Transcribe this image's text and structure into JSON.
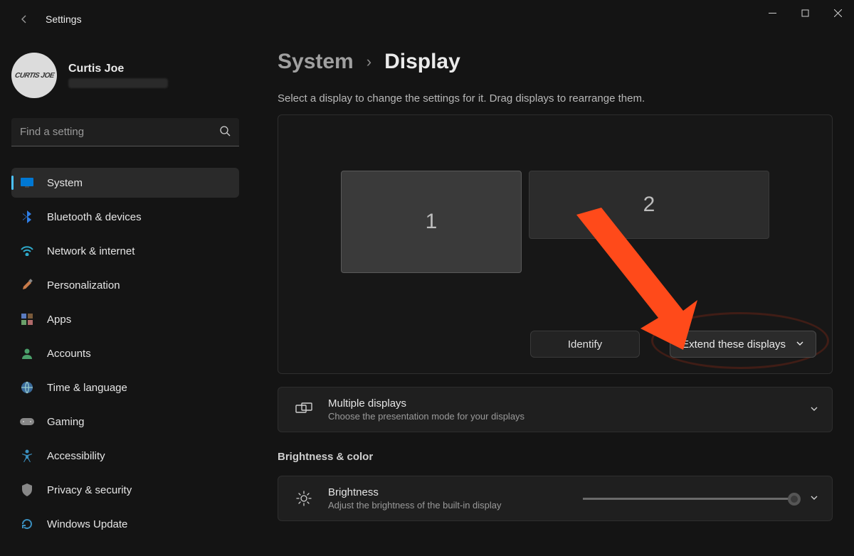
{
  "app": {
    "title": "Settings"
  },
  "user": {
    "name": "Curtis Joe",
    "avatar_text": "CURTIS JOE"
  },
  "search": {
    "placeholder": "Find a setting"
  },
  "nav": [
    {
      "label": "System",
      "icon": "display-icon",
      "active": true
    },
    {
      "label": "Bluetooth & devices",
      "icon": "bluetooth-icon"
    },
    {
      "label": "Network & internet",
      "icon": "wifi-icon"
    },
    {
      "label": "Personalization",
      "icon": "brush-icon"
    },
    {
      "label": "Apps",
      "icon": "apps-icon"
    },
    {
      "label": "Accounts",
      "icon": "person-icon"
    },
    {
      "label": "Time & language",
      "icon": "globe-icon"
    },
    {
      "label": "Gaming",
      "icon": "gamepad-icon"
    },
    {
      "label": "Accessibility",
      "icon": "accessibility-icon"
    },
    {
      "label": "Privacy & security",
      "icon": "shield-icon"
    },
    {
      "label": "Windows Update",
      "icon": "update-icon"
    }
  ],
  "breadcrumb": {
    "parent": "System",
    "current": "Display"
  },
  "hint": "Select a display to change the settings for it. Drag displays to rearrange them.",
  "displays": {
    "d1": "1",
    "d2": "2"
  },
  "identify": "Identify",
  "extend_dropdown": "Extend these displays",
  "multiple_card": {
    "title": "Multiple displays",
    "sub": "Choose the presentation mode for your displays"
  },
  "brightness_section": "Brightness & color",
  "brightness_card": {
    "title": "Brightness",
    "sub": "Adjust the brightness of the built-in display"
  }
}
